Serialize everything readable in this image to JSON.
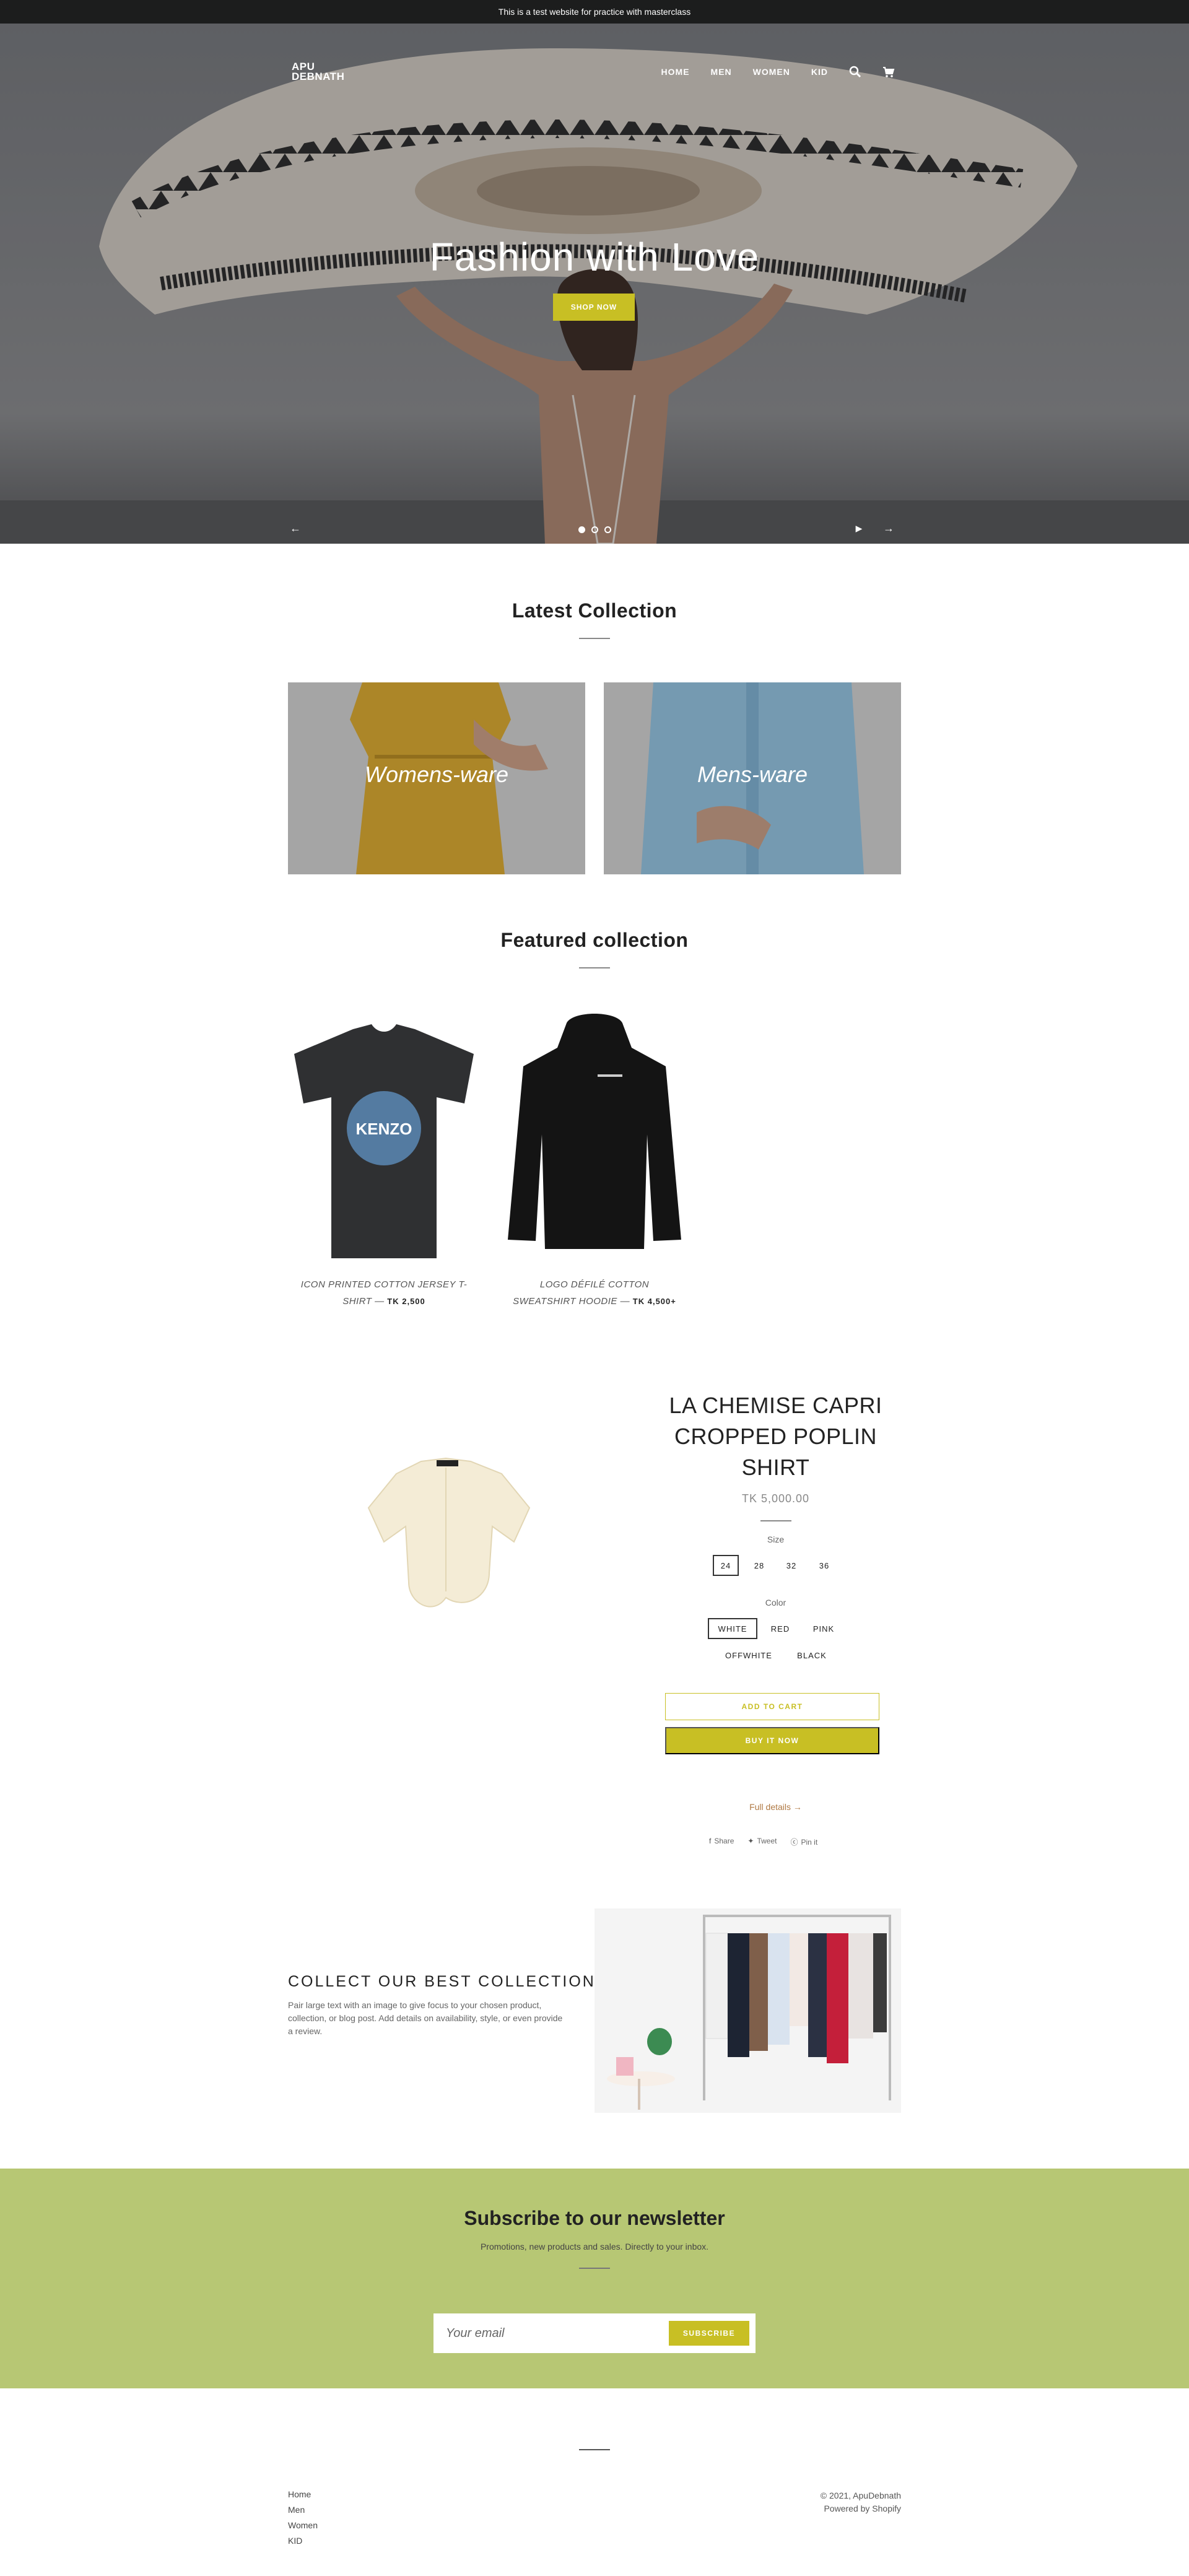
{
  "announcement": "This is a test website for practice with masterclass",
  "header": {
    "logo_line1": "APU",
    "logo_line2": "DEBNATH",
    "nav": [
      "HOME",
      "MEN",
      "WOMEN",
      "KID"
    ],
    "icons": [
      "search-icon",
      "cart-icon"
    ]
  },
  "hero": {
    "title": "Fashion with Love",
    "button": "SHOP NOW",
    "slide_count": 3,
    "active_slide": 1
  },
  "latest": {
    "title": "Latest Collection",
    "tiles": [
      {
        "label": "Womens-ware"
      },
      {
        "label": "Mens-ware"
      }
    ]
  },
  "featured": {
    "title": "Featured collection",
    "products": [
      {
        "name_line1": "ICON PRINTED COTTON JERSEY T-",
        "name_line2": "SHIRT",
        "price": "TK 2,500"
      },
      {
        "name_line1": "LOGO DÉFILÉ COTTON",
        "name_line2": "SWEATSHIRT HOODIE",
        "price": "TK 4,500+"
      }
    ],
    "tshirt_brand": "KENZO"
  },
  "featured_product": {
    "title_line1": "LA CHEMISE CAPRI",
    "title_line2": "CROPPED POPLIN",
    "title_line3": "SHIRT",
    "price": "TK 5,000.00",
    "size_label": "Size",
    "sizes": [
      "24",
      "28",
      "32",
      "36"
    ],
    "selected_size": "24",
    "color_label": "Color",
    "colors": [
      "WHITE",
      "RED",
      "PINK",
      "OFFWHITE",
      "BLACK"
    ],
    "selected_color": "WHITE",
    "add_to_cart": "ADD TO CART",
    "buy_now": "BUY IT NOW",
    "full_details": "Full details →",
    "share": [
      {
        "icon": "facebook-icon",
        "label": "Share"
      },
      {
        "icon": "twitter-icon",
        "label": "Tweet"
      },
      {
        "icon": "pinterest-icon",
        "label": "Pin it"
      }
    ]
  },
  "image_text": {
    "title": "COLLECT OUR BEST COLLECTION",
    "body": "Pair large text with an image to give focus to your chosen product, collection, or blog post. Add details on availability, style, or even provide a review."
  },
  "newsletter": {
    "title": "Subscribe to our newsletter",
    "subtitle": "Promotions, new products and sales. Directly to your inbox.",
    "placeholder": "Your email",
    "button": "SUBSCRIBE"
  },
  "footer": {
    "links": [
      "Home",
      "Men",
      "Women",
      "KID"
    ],
    "copyright": "© 2021, ApuDebnath",
    "powered": "Powered by Shopify"
  },
  "colors": {
    "accent": "#c8bf24",
    "newsletter_bg": "#b7c774",
    "announcement_bg": "#1c1d1d",
    "link_accent": "#b07a45"
  }
}
